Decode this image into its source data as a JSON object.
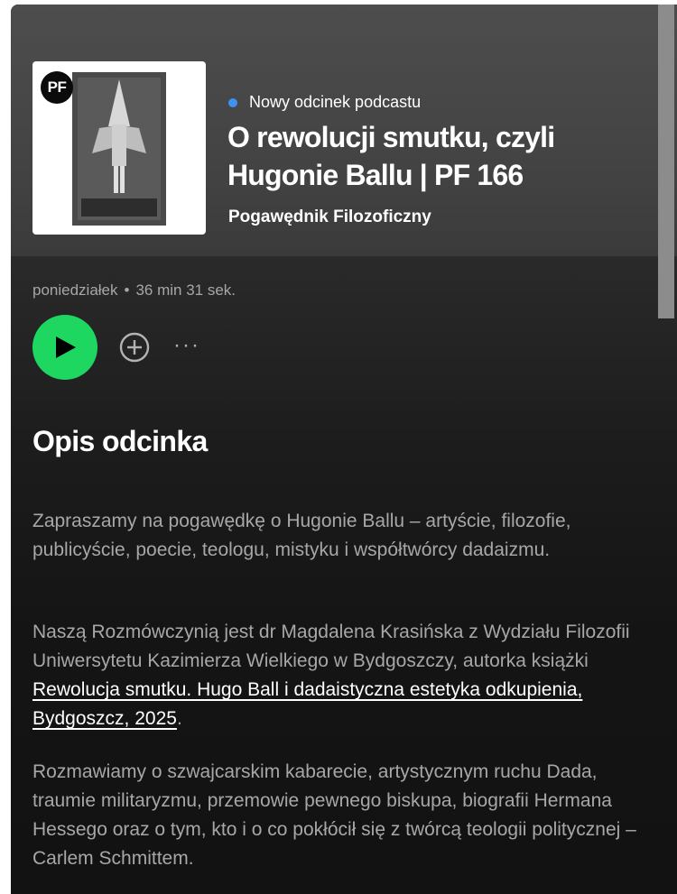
{
  "episode": {
    "cover": {
      "badge": "PF"
    },
    "tag": "Nowy odcinek podcastu",
    "title": "O rewolucji smutku, czyli Hugonie Ballu | PF 166",
    "show": "Pogawędnik Filozoficzny",
    "date": "poniedziałek",
    "separator": "•",
    "duration": "36 min 31 sek."
  },
  "actions": {
    "play_icon": "play-icon",
    "add_icon": "add-circle-icon",
    "more_icon": "more-icon",
    "more_glyph": "···",
    "play_color": "#1ed760"
  },
  "description": {
    "heading": "Opis odcinka",
    "p1": "Zapraszamy na pogawędkę o Hugonie Ballu – artyście, filozofie, publicyście, poecie, teologu, mistyku i współtwórcy dadaizmu.",
    "p2_before": "Naszą Rozmówczynią jest dr Magdalena Krasińska z Wydziału Filozofii Uniwersytetu Kazimierza Wielkiego w Bydgoszczy, autorka książki ",
    "p2_link": "Rewolucja smutku. Hugo Ball i dadaistyczna estetyka odkupienia, Bydgoszcz, 2025",
    "p2_after": ".",
    "p3": "Rozmawiamy o szwajcarskim kabarecie, artystycznym ruchu Dada,  traumie militaryzmu, przemowie pewnego biskupa, biografii Hermana Hessego oraz o tym, kto i o co pokłócił się z twórcą  teologii politycznej – Carlem Schmittem."
  },
  "colors": {
    "background": "#121212",
    "hero": "#4d4d4d",
    "accent_dot": "#3d91f4",
    "secondary_text": "#a7a7a7"
  }
}
